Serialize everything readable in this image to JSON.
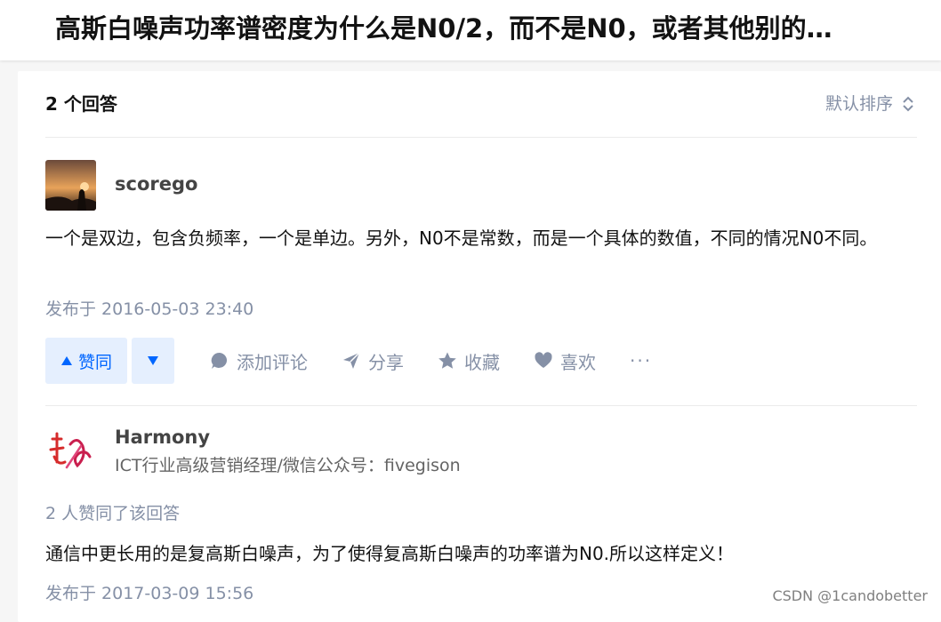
{
  "question": {
    "title": "高斯白噪声功率谱密度为什么是N0/2，而不是N0，或者其他别的…"
  },
  "answers_header": {
    "count_label": "2 个回答",
    "sort_label": "默认排序"
  },
  "answers": [
    {
      "author": "scorego",
      "content": "一个是双边，包含负频率，一个是单边。另外，N0不是常数，而是一个具体的数值，不同的情况N0不同。",
      "published": "发布于 2016-05-03 23:40",
      "actions": {
        "upvote": "赞同",
        "comment": "添加评论",
        "share": "分享",
        "collect": "收藏",
        "like": "喜欢",
        "more": "···"
      }
    },
    {
      "author": "Harmony",
      "bio": "ICT行业高级营销经理/微信公众号：fivegison",
      "votes": "2 人赞同了该回答",
      "content": "通信中更长用的是复高斯白噪声，为了使得复高斯白噪声的功率谱为N0.所以这样定义！",
      "published": "发布于 2017-03-09 15:56"
    }
  ],
  "watermark": "CSDN @1candobetter",
  "colors": {
    "accent": "#0066ff",
    "vote_bg": "#e5effe",
    "muted": "#8590a6"
  }
}
